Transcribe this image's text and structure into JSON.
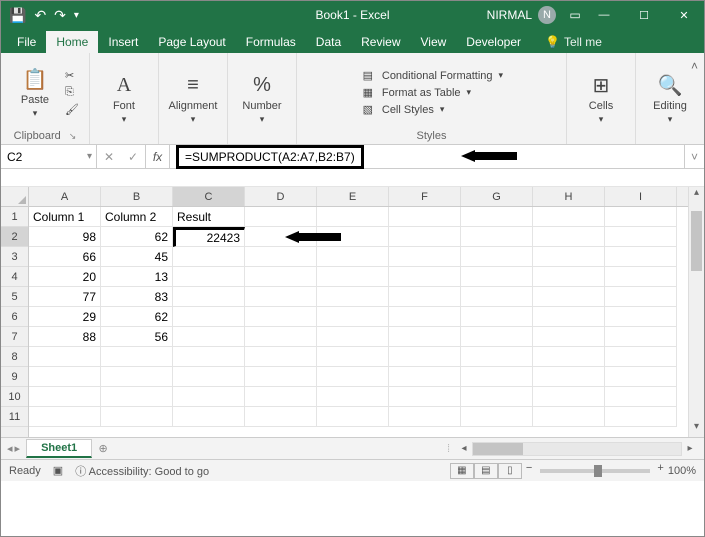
{
  "title": "Book1 - Excel",
  "user": {
    "name": "NIRMAL",
    "initial": "N"
  },
  "qat": {
    "save": "💾",
    "undo": "↶",
    "redo": "↷"
  },
  "tabs": [
    "File",
    "Home",
    "Insert",
    "Page Layout",
    "Formulas",
    "Data",
    "Review",
    "View",
    "Developer"
  ],
  "active_tab": "Home",
  "tellme": "Tell me",
  "ribbon": {
    "clipboard": {
      "paste": "Paste",
      "label": "Clipboard"
    },
    "font": {
      "label": "Font"
    },
    "alignment": {
      "label": "Alignment"
    },
    "number": {
      "label": "Number"
    },
    "styles": {
      "cond": "Conditional Formatting",
      "table": "Format as Table",
      "cell": "Cell Styles",
      "label": "Styles"
    },
    "cells": {
      "label": "Cells"
    },
    "editing": {
      "label": "Editing"
    }
  },
  "namebox": "C2",
  "formula": "=SUMPRODUCT(A2:A7,B2:B7)",
  "columns": [
    "A",
    "B",
    "C",
    "D",
    "E",
    "F",
    "G",
    "H",
    "I"
  ],
  "rows": [
    "1",
    "2",
    "3",
    "4",
    "5",
    "6",
    "7",
    "8",
    "9",
    "10",
    "11"
  ],
  "headers": {
    "A": "Column 1",
    "B": "Column 2",
    "C": "Result"
  },
  "data": {
    "A": [
      "98",
      "66",
      "20",
      "77",
      "29",
      "88"
    ],
    "B": [
      "62",
      "45",
      "13",
      "83",
      "62",
      "56"
    ]
  },
  "result": "22423",
  "sheet": "Sheet1",
  "status": {
    "ready": "Ready",
    "access": "Accessibility: Good to go",
    "zoom": "100%"
  }
}
